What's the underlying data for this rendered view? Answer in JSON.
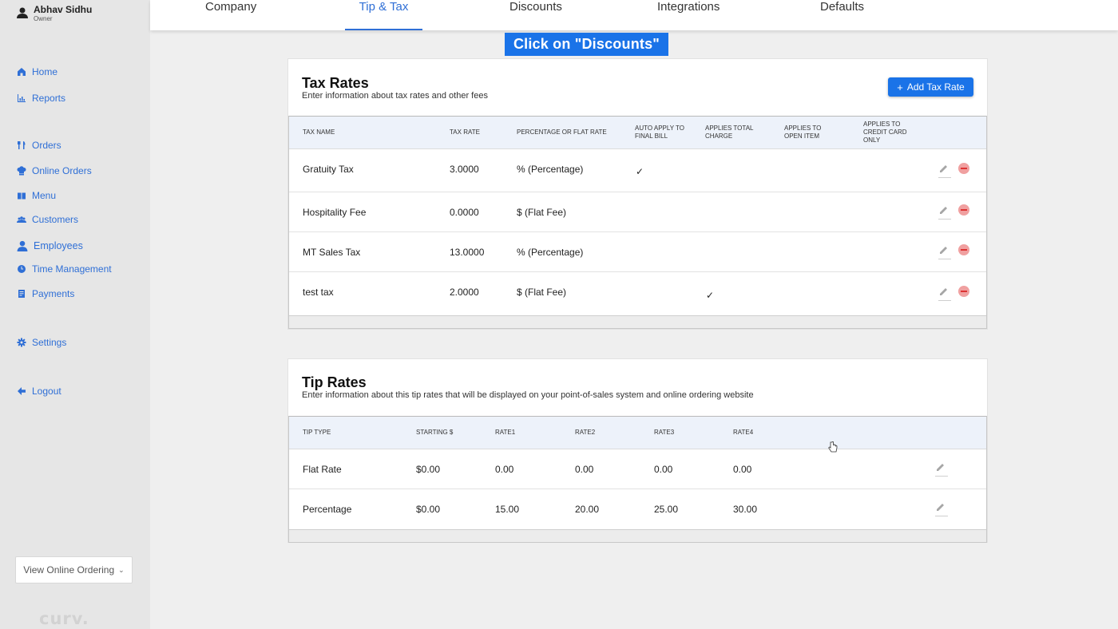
{
  "user": {
    "name": "Abhav Sidhu",
    "role": "Owner"
  },
  "sidebar": {
    "items": [
      {
        "label": "Home",
        "icon": "home-icon"
      },
      {
        "label": "Reports",
        "icon": "chart-icon"
      },
      {
        "label": "Orders",
        "icon": "fork-knife-icon"
      },
      {
        "label": "Online Orders",
        "icon": "chef-hat-icon"
      },
      {
        "label": "Menu",
        "icon": "book-icon"
      },
      {
        "label": "Customers",
        "icon": "group-icon"
      },
      {
        "label": "Employees",
        "icon": "person-icon"
      },
      {
        "label": "Time Management",
        "icon": "clock-icon"
      },
      {
        "label": "Payments",
        "icon": "receipt-icon"
      },
      {
        "label": "Settings",
        "icon": "gear-icon"
      },
      {
        "label": "Logout",
        "icon": "arrow-left-icon"
      }
    ],
    "view_online": "View Online Ordering",
    "brand": "curv."
  },
  "tabs": [
    {
      "label": "Company"
    },
    {
      "label": "Tip & Tax",
      "active": true
    },
    {
      "label": "Discounts"
    },
    {
      "label": "Integrations"
    },
    {
      "label": "Defaults"
    }
  ],
  "instruction": "Click on \"Discounts\"",
  "tax": {
    "title": "Tax Rates",
    "subtitle": "Enter information about tax rates and other fees",
    "add_label": "Add Tax Rate",
    "headers": [
      "TAX NAME",
      "TAX RATE",
      "PERCENTAGE OR FLAT RATE",
      "AUTO APPLY TO FINAL BILL",
      "APPLIES TOTAL CHARGE",
      "APPLIES TO OPEN ITEM",
      "APPLIES TO CREDIT CARD ONLY"
    ],
    "rows": [
      {
        "name": "Gratuity Tax",
        "rate": "3.0000",
        "type": "% (Percentage)",
        "auto_apply": "✓",
        "total_charge": ""
      },
      {
        "name": "Hospitality Fee",
        "rate": "0.0000",
        "type": "$ (Flat Fee)",
        "auto_apply": "",
        "total_charge": ""
      },
      {
        "name": "MT Sales Tax",
        "rate": "13.0000",
        "type": "% (Percentage)",
        "auto_apply": "",
        "total_charge": ""
      },
      {
        "name": "test tax",
        "rate": "2.0000",
        "type": "$ (Flat Fee)",
        "auto_apply": "",
        "total_charge": "✓"
      }
    ]
  },
  "tip": {
    "title": "Tip Rates",
    "subtitle": "Enter information about this tip rates that will be displayed on your point-of-sales system and online ordering website",
    "headers": [
      "TIP TYPE",
      "STARTING $",
      "RATE1",
      "RATE2",
      "RATE3",
      "RATE4"
    ],
    "rows": [
      {
        "type": "Flat Rate",
        "start": "$0.00",
        "r1": "0.00",
        "r2": "0.00",
        "r3": "0.00",
        "r4": "0.00"
      },
      {
        "type": "Percentage",
        "start": "$0.00",
        "r1": "15.00",
        "r2": "20.00",
        "r3": "25.00",
        "r4": "30.00"
      }
    ]
  },
  "colors": {
    "accent": "#1a73e8",
    "link": "#2f6fd6",
    "delete": "#f0a0a0"
  }
}
